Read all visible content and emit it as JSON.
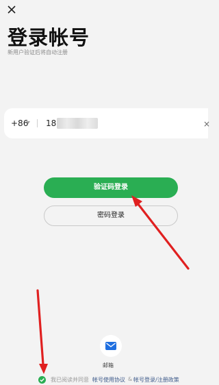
{
  "header": {
    "close_icon": "close-icon",
    "title": "登录帐号",
    "subtitle": "新用户验证后将自动注册"
  },
  "phone": {
    "country_code": "+86",
    "value": "18",
    "clear_icon": "clear-icon",
    "clear_glyph": "×"
  },
  "buttons": {
    "sms_login": "验证码登录",
    "password_login": "密码登录"
  },
  "alt_login": {
    "email_icon": "mail-icon",
    "email_label": "邮箱"
  },
  "agreement": {
    "prefix": "我已阅读并同意",
    "user_agreement": "帐号使用协议",
    "separator": "&",
    "privacy_policy": "帐号登录/注册政策"
  },
  "colors": {
    "accent": "#2aae53",
    "link": "#3d5a8a",
    "annotation_arrow": "#e02020"
  }
}
